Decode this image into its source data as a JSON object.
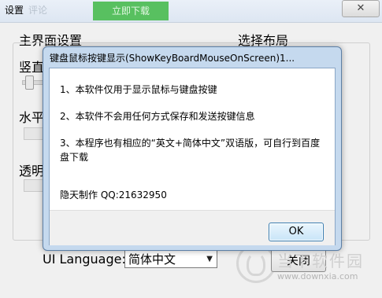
{
  "background_window": {
    "title": "设置",
    "title_ghost": "评论",
    "green_button_label": "立即下载",
    "close_label": "✕",
    "main_section_title": "主界面设置",
    "layout_section_title": "选择布局",
    "labels": [
      "竖直",
      "水平",
      "透明"
    ],
    "ui_language_label": "UI Language:",
    "ui_language_value": "简体中文",
    "close_button_label": "关闭",
    "watermark_text": "当下软件园",
    "watermark_url": "www.downxia.com"
  },
  "dialog": {
    "title": "键盘鼠标按键显示(ShowKeyBoardMouseOnScreen)1...",
    "lines": [
      "1、本软件仅用于显示鼠标与键盘按键",
      "2、本软件不会用任何方式保存和发送按键信息",
      "3、本程序也有相应的“英文+简体中文”双语版，可自行到百度",
      "盘下载",
      "隐天制作 QQ:21632950"
    ],
    "ok_label": "OK"
  }
}
